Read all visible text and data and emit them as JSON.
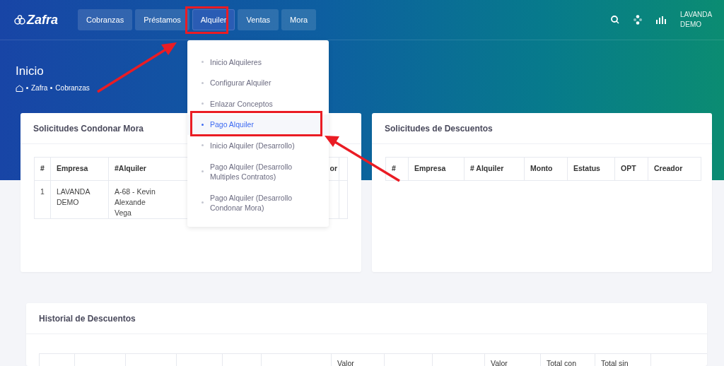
{
  "navbar": {
    "logo": "Zafra",
    "menu": [
      {
        "label": "Cobranzas",
        "selected": false
      },
      {
        "label": "Préstamos",
        "selected": false
      },
      {
        "label": "Alquiler",
        "selected": true
      },
      {
        "label": "Ventas",
        "selected": false
      },
      {
        "label": "Mora",
        "selected": false
      }
    ],
    "user": "LAVANDA DEMO"
  },
  "page_header": {
    "title": "Inicio",
    "breadcrumb": [
      "Zafra",
      "Cobranzas"
    ]
  },
  "dropdown": {
    "items": [
      {
        "label": "Inicio Alquileres",
        "selected": false
      },
      {
        "label": "Configurar Alquiler",
        "selected": false
      },
      {
        "label": "Enlazar Conceptos",
        "selected": false
      },
      {
        "label": "Pago Alquiler",
        "selected": true
      },
      {
        "label": "Inicio Alquiler (Desarrollo)",
        "selected": false
      },
      {
        "label": "Pago Alquiler (Desarrollo Multiples Contratos)",
        "selected": false
      },
      {
        "label": "Pago Alquiler (Desarrollo Condonar Mora)",
        "selected": false
      }
    ]
  },
  "cards": [
    {
      "title": "Solicitudes Condonar Mora",
      "columns": [
        {
          "label": "#"
        },
        {
          "label": "Empresa"
        },
        {
          "label": "#Alquiler"
        },
        {},
        {
          "label": "or"
        },
        {}
      ],
      "rows": [
        [
          {
            "lines": [
              "1"
            ]
          },
          {
            "lines": [
              "LAVANDA",
              "DEMO"
            ]
          },
          {
            "lines": [
              "A-68 - Kevin Alexande",
              "Vega"
            ]
          },
          {},
          {},
          {}
        ]
      ]
    },
    {
      "title": "Solicitudes de Descuentos",
      "columns": [
        {
          "label": "#"
        },
        {
          "label": "Empresa"
        },
        {
          "label": "# Alquiler"
        },
        {
          "label": "Monto"
        },
        {
          "label": "Estatus"
        },
        {
          "label": "OPT"
        },
        {
          "label": "Creador"
        }
      ]
    },
    {
      "title": "Historial de Descuentos",
      "columns": [
        {},
        {},
        {},
        {},
        {},
        {},
        {
          "label": "Valor"
        },
        {},
        {},
        {
          "label": "Valor"
        },
        {
          "label": "Total con"
        },
        {
          "label": "Total sin"
        },
        {}
      ]
    }
  ]
}
